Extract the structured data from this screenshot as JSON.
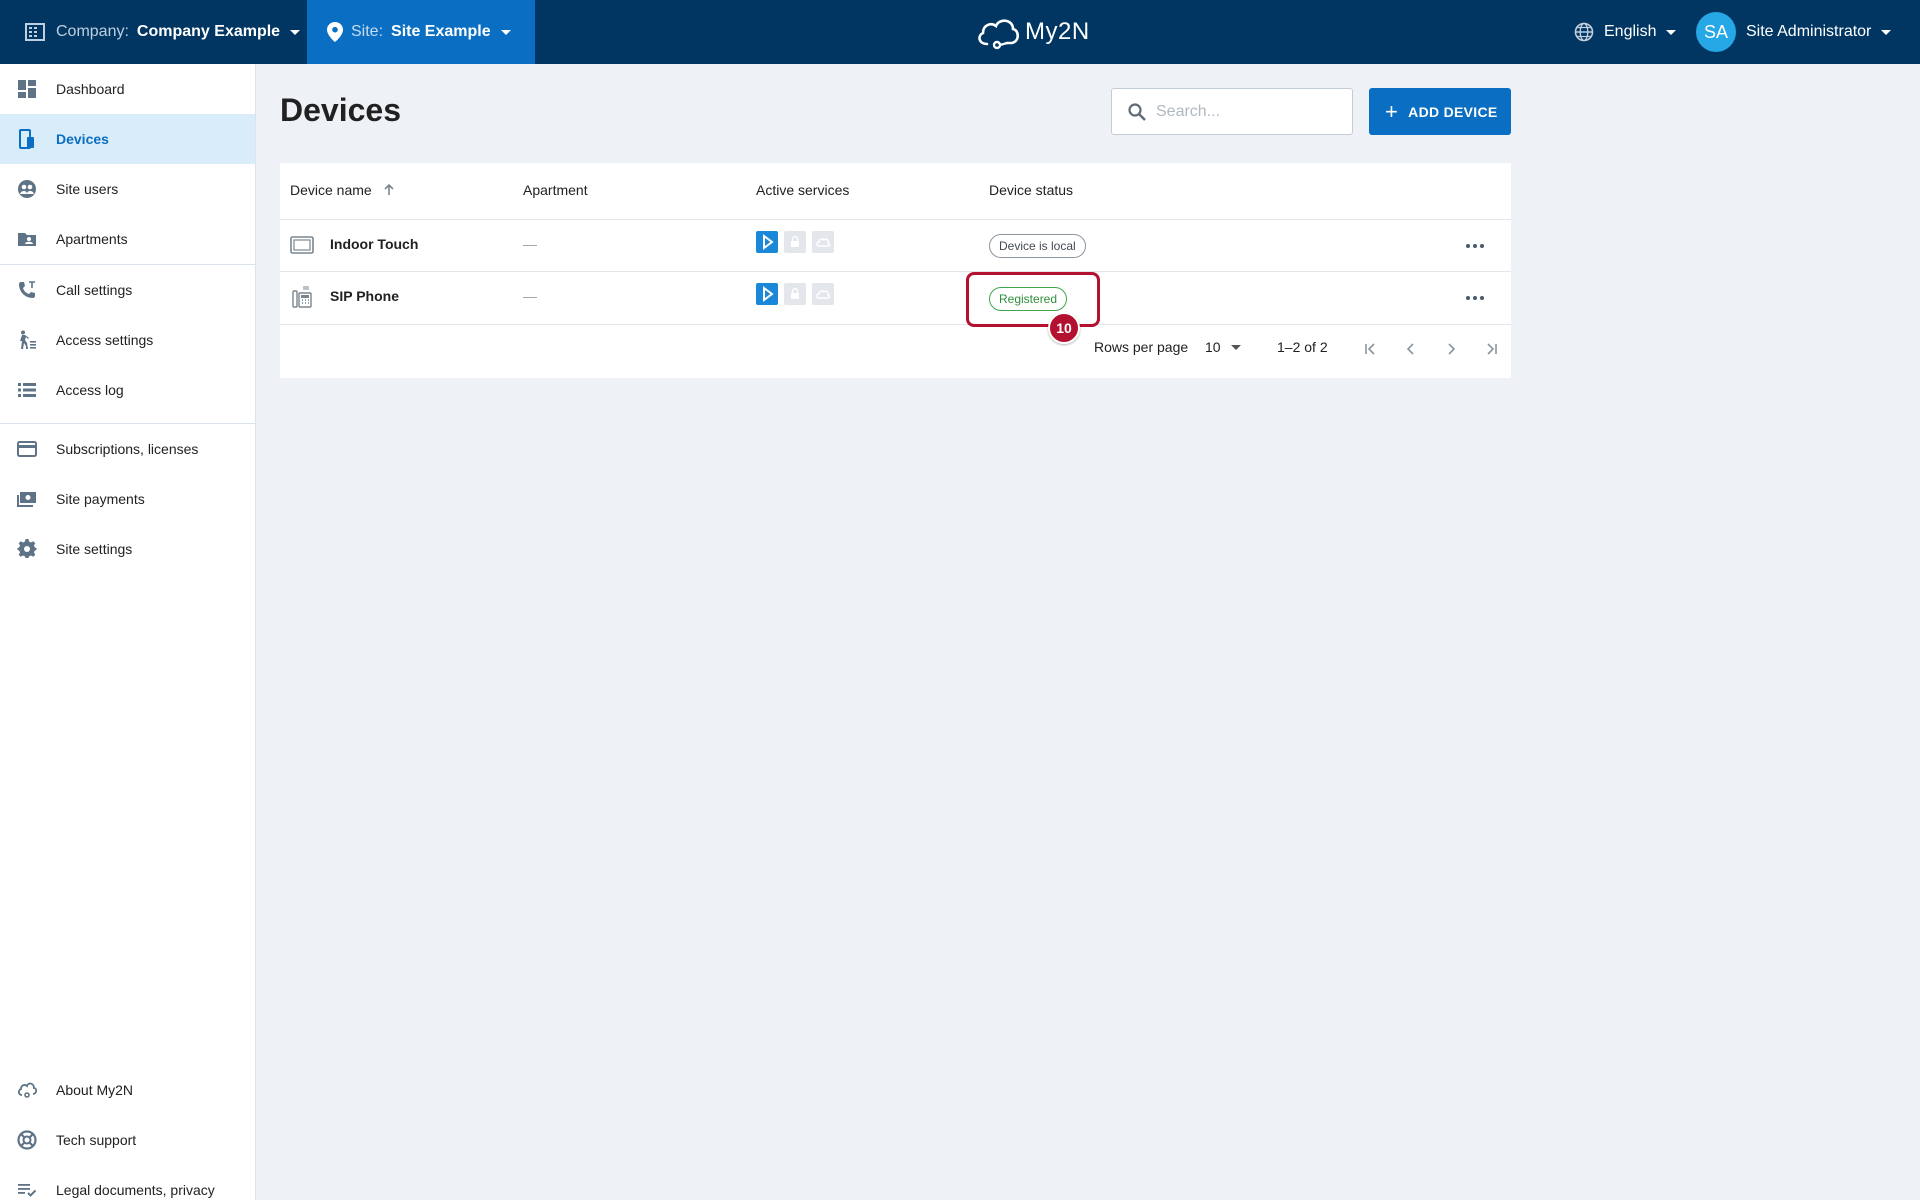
{
  "header": {
    "company_label": "Company:",
    "company_name": "Company Example",
    "site_label": "Site:",
    "site_name": "Site Example",
    "logo_text": "My2N",
    "language": "English",
    "user_initials": "SA",
    "user_name": "Site Administrator"
  },
  "sidebar": {
    "items": [
      {
        "label": "Dashboard",
        "icon": "dashboard-icon"
      },
      {
        "label": "Devices",
        "icon": "devices-icon",
        "active": true
      },
      {
        "label": "Site users",
        "icon": "site-users-icon"
      },
      {
        "label": "Apartments",
        "icon": "apartments-icon"
      },
      {
        "label": "Call settings",
        "icon": "phone-icon"
      },
      {
        "label": "Access settings",
        "icon": "walking-person-icon"
      },
      {
        "label": "Access log",
        "icon": "list-icon"
      },
      {
        "label": "Subscriptions, licenses",
        "icon": "credit-card-icon"
      },
      {
        "label": "Site payments",
        "icon": "payments-icon"
      },
      {
        "label": "Site settings",
        "icon": "gear-icon"
      }
    ],
    "footer": [
      {
        "label": "About My2N",
        "icon": "cloud-info-icon"
      },
      {
        "label": "Tech support",
        "icon": "lifebuoy-icon"
      },
      {
        "label": "Legal documents, privacy",
        "icon": "checklist-icon"
      }
    ]
  },
  "main": {
    "title": "Devices",
    "search_placeholder": "Search...",
    "add_button": "ADD DEVICE",
    "columns": [
      "Device name",
      "Apartment",
      "Active services",
      "Device status"
    ],
    "rows": [
      {
        "name": "Indoor Touch",
        "apartment": "—",
        "status": "Device is local",
        "icon": "indoor-touch-icon"
      },
      {
        "name": "SIP Phone",
        "apartment": "—",
        "status": "Registered",
        "icon": "sip-phone-icon"
      }
    ],
    "pagination": {
      "rows_per_page_label": "Rows per page",
      "rows_per_page_value": "10",
      "range": "1–2 of 2"
    },
    "annotation_number": "10"
  },
  "colors": {
    "topbar": "#013662",
    "site_selector": "#0a6fc2",
    "accent": "#0a6fc2",
    "registered": "#3fa54a",
    "annotation": "#b3112f"
  }
}
